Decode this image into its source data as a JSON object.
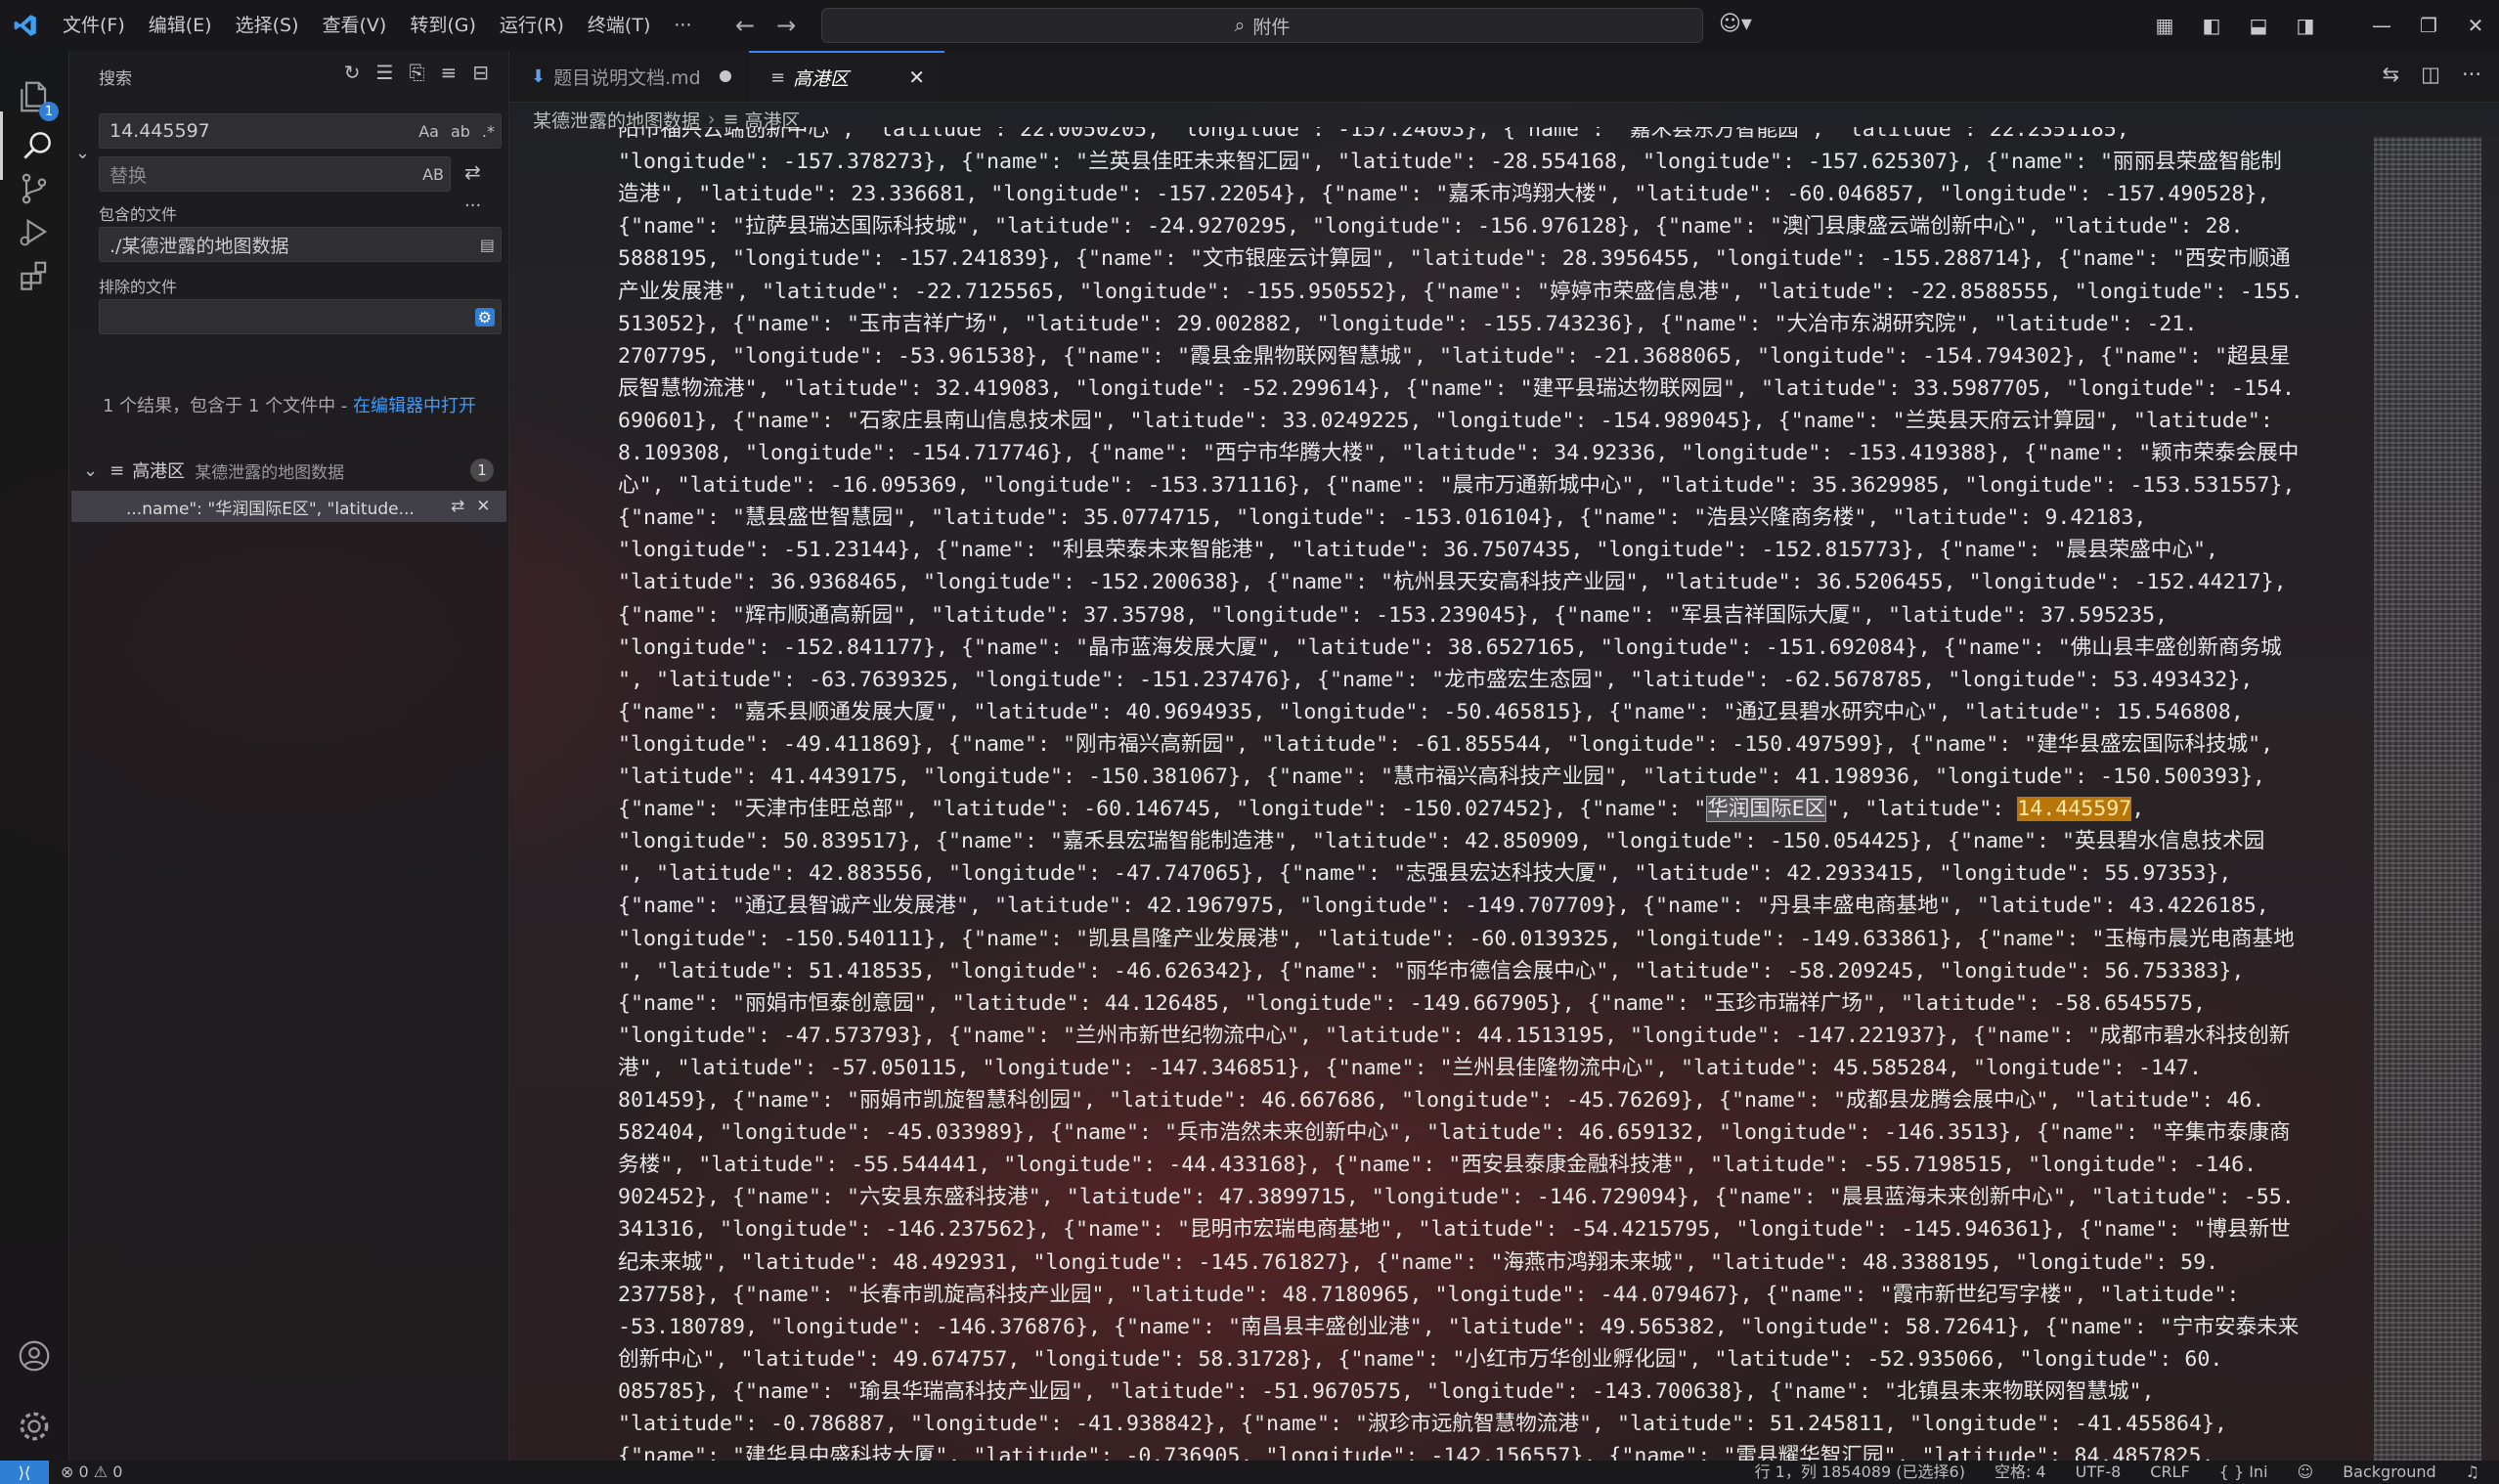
{
  "titlebar": {
    "menu": [
      "文件(F)",
      "编辑(E)",
      "选择(S)",
      "查看(V)",
      "转到(G)",
      "运行(R)",
      "终端(T)",
      "···"
    ],
    "command_center": "附件"
  },
  "activity": {
    "explorer_badge": "1"
  },
  "search": {
    "header": "搜索",
    "query": "14.445597",
    "query_tools": [
      "Aa",
      "ab",
      ".*"
    ],
    "replace_placeholder": "替换",
    "replace_tool": "AB",
    "include_label": "包含的文件",
    "include_value": "./某德泄露的地图数据",
    "exclude_label": "排除的文件",
    "exclude_value": "",
    "results_summary": "1 个结果，包含于 1 个文件中 - ",
    "open_in_editor": "在编辑器中打开",
    "file": {
      "name": "高港区",
      "path": "某德泄露的地图数据",
      "count": "1"
    },
    "match": "...name\": \"华润国际E区\", \"latitude..."
  },
  "tabs": [
    {
      "label": "题目说明文档.md",
      "modified": true
    },
    {
      "label": "高港区",
      "active": true
    }
  ],
  "breadcrumb": [
    "某德泄露的地图数据",
    "高港区"
  ],
  "editor": {
    "line_segments": [
      [
        "阳市福兴云端创新中心\", \"latitude\": 22.0050205, \"longitude\": -157.24603}, {\"name\": \"嘉禾县东方智能园\", \"latitude\": 22.2351185,"
      ],
      [
        "\"longitude\": -157.378273}, {\"name\": \"兰英县佳旺未来智汇园\", \"latitude\": -28.554168, \"longitude\": -157.625307}, {\"name\": \"丽丽县荣盛智能制"
      ],
      [
        "造港\", \"latitude\": 23.336681, \"longitude\": -157.22054}, {\"name\": \"嘉禾市鸿翔大楼\", \"latitude\": -60.046857, \"longitude\": -157.490528},"
      ],
      [
        "{\"name\": \"拉萨县瑞达国际科技城\", \"latitude\": -24.9270295, \"longitude\": -156.976128}, {\"name\": \"澳门县康盛云端创新中心\", \"latitude\": 28."
      ],
      [
        "5888195, \"longitude\": -157.241839}, {\"name\": \"文市银座云计算园\", \"latitude\": 28.3956455, \"longitude\": -155.288714}, {\"name\": \"西安市顺通"
      ],
      [
        "产业发展港\", \"latitude\": -22.7125565, \"longitude\": -155.950552}, {\"name\": \"婷婷市荣盛信息港\", \"latitude\": -22.8588555, \"longitude\": -155."
      ],
      [
        "513052}, {\"name\": \"玉市吉祥广场\", \"latitude\": 29.002882, \"longitude\": -155.743236}, {\"name\": \"大冶市东湖研究院\", \"latitude\": -21."
      ],
      [
        "2707795, \"longitude\": -53.961538}, {\"name\": \"霞县金鼎物联网智慧城\", \"latitude\": -21.3688065, \"longitude\": -154.794302}, {\"name\": \"超县星"
      ],
      [
        "辰智慧物流港\", \"latitude\": 32.419083, \"longitude\": -52.299614}, {\"name\": \"建平县瑞达物联网园\", \"latitude\": 33.5987705, \"longitude\": -154."
      ],
      [
        "690601}, {\"name\": \"石家庄县南山信息技术园\", \"latitude\": 33.0249225, \"longitude\": -154.989045}, {\"name\": \"兰英县天府云计算园\", \"latitude\":"
      ],
      [
        "8.109308, \"longitude\": -154.717746}, {\"name\": \"西宁市华腾大楼\", \"latitude\": 34.92336, \"longitude\": -153.419388}, {\"name\": \"颖市荣泰会展中"
      ],
      [
        "心\", \"latitude\": -16.095369, \"longitude\": -153.371116}, {\"name\": \"晨市万通新城中心\", \"latitude\": 35.3629985, \"longitude\": -153.531557},"
      ],
      [
        "{\"name\": \"慧县盛世智慧园\", \"latitude\": 35.0774715, \"longitude\": -153.016104}, {\"name\": \"浩县兴隆商务楼\", \"latitude\": 9.42183,"
      ],
      [
        "\"longitude\": -51.23144}, {\"name\": \"利县荣泰未来智能港\", \"latitude\": 36.7507435, \"longitude\": -152.815773}, {\"name\": \"晨县荣盛中心\","
      ],
      [
        "\"latitude\": 36.9368465, \"longitude\": -152.200638}, {\"name\": \"杭州县天安高科技产业园\", \"latitude\": 36.5206455, \"longitude\": -152.44217},"
      ],
      [
        "{\"name\": \"辉市顺通高新园\", \"latitude\": 37.35798, \"longitude\": -153.239045}, {\"name\": \"军县吉祥国际大厦\", \"latitude\": 37.595235,"
      ],
      [
        "\"longitude\": -152.841177}, {\"name\": \"晶市蓝海发展大厦\", \"latitude\": 38.6527165, \"longitude\": -151.692084}, {\"name\": \"佛山县丰盛创新商务城"
      ],
      [
        "\", \"latitude\": -63.7639325, \"longitude\": -151.237476}, {\"name\": \"龙市盛宏生态园\", \"latitude\": -62.5678785, \"longitude\": 53.493432},"
      ],
      [
        "{\"name\": \"嘉禾县顺通发展大厦\", \"latitude\": 40.9694935, \"longitude\": -50.465815}, {\"name\": \"通辽县碧水研究中心\", \"latitude\": 15.546808,"
      ],
      [
        "\"longitude\": -49.411869}, {\"name\": \"刚市福兴高新园\", \"latitude\": -61.855544, \"longitude\": -150.497599}, {\"name\": \"建华县盛宏国际科技城\","
      ],
      [
        "\"latitude\": 41.4439175, \"longitude\": -150.381067}, {\"name\": \"慧市福兴高科技产业园\", \"latitude\": 41.198936, \"longitude\": -150.500393},"
      ],
      [
        "{\"name\": \"天津市佳旺总部\", \"latitude\": -60.146745, \"longitude\": -150.027452}, {\"name\": \"",
        "华润国际E区",
        "\", \"latitude\": ",
        "14.445597",
        ","
      ],
      [
        "\"longitude\": 50.839517}, {\"name\": \"嘉禾县宏瑞智能制造港\", \"latitude\": 42.850909, \"longitude\": -150.054425}, {\"name\": \"英县碧水信息技术园"
      ],
      [
        "\", \"latitude\": 42.883556, \"longitude\": -47.747065}, {\"name\": \"志强县宏达科技大厦\", \"latitude\": 42.2933415, \"longitude\": 55.97353},"
      ],
      [
        "{\"name\": \"通辽县智诚产业发展港\", \"latitude\": 42.1967975, \"longitude\": -149.707709}, {\"name\": \"丹县丰盛电商基地\", \"latitude\": 43.4226185,"
      ],
      [
        "\"longitude\": -150.540111}, {\"name\": \"凯县昌隆产业发展港\", \"latitude\": -60.0139325, \"longitude\": -149.633861}, {\"name\": \"玉梅市晨光电商基地"
      ],
      [
        "\", \"latitude\": 51.418535, \"longitude\": -46.626342}, {\"name\": \"丽华市德信会展中心\", \"latitude\": -58.209245, \"longitude\": 56.753383},"
      ],
      [
        "{\"name\": \"丽娟市恒泰创意园\", \"latitude\": 44.126485, \"longitude\": -149.667905}, {\"name\": \"玉珍市瑞祥广场\", \"latitude\": -58.6545575,"
      ],
      [
        "\"longitude\": -47.573793}, {\"name\": \"兰州市新世纪物流中心\", \"latitude\": 44.1513195, \"longitude\": -147.221937}, {\"name\": \"成都市碧水科技创新"
      ],
      [
        "港\", \"latitude\": -57.050115, \"longitude\": -147.346851}, {\"name\": \"兰州县佳隆物流中心\", \"latitude\": 45.585284, \"longitude\": -147."
      ],
      [
        "801459}, {\"name\": \"丽娟市凯旋智慧科创园\", \"latitude\": 46.667686, \"longitude\": -45.76269}, {\"name\": \"成都县龙腾会展中心\", \"latitude\": 46."
      ],
      [
        "582404, \"longitude\": -45.033989}, {\"name\": \"兵市浩然未来创新中心\", \"latitude\": 46.659132, \"longitude\": -146.3513}, {\"name\": \"辛集市泰康商"
      ],
      [
        "务楼\", \"latitude\": -55.544441, \"longitude\": -44.433168}, {\"name\": \"西安县泰康金融科技港\", \"latitude\": -55.7198515, \"longitude\": -146."
      ],
      [
        "902452}, {\"name\": \"六安县东盛科技港\", \"latitude\": 47.3899715, \"longitude\": -146.729094}, {\"name\": \"晨县蓝海未来创新中心\", \"latitude\": -55."
      ],
      [
        "341316, \"longitude\": -146.237562}, {\"name\": \"昆明市宏瑞电商基地\", \"latitude\": -54.4215795, \"longitude\": -145.946361}, {\"name\": \"博县新世"
      ],
      [
        "纪未来城\", \"latitude\": 48.492931, \"longitude\": -145.761827}, {\"name\": \"海燕市鸿翔未来城\", \"latitude\": 48.3388195, \"longitude\": 59."
      ],
      [
        "237758}, {\"name\": \"长春市凯旋高科技产业园\", \"latitude\": 48.7180965, \"longitude\": -44.079467}, {\"name\": \"霞市新世纪写字楼\", \"latitude\":"
      ],
      [
        "-53.180789, \"longitude\": -146.376876}, {\"name\": \"南昌县丰盛创业港\", \"latitude\": 49.565382, \"longitude\": 58.72641}, {\"name\": \"宁市安泰未来"
      ],
      [
        "创新中心\", \"latitude\": 49.674757, \"longitude\": 58.31728}, {\"name\": \"小红市万华创业孵化园\", \"latitude\": -52.935066, \"longitude\": 60."
      ],
      [
        "085785}, {\"name\": \"瑜县华瑞高科技产业园\", \"latitude\": -51.9670575, \"longitude\": -143.700638}, {\"name\": \"北镇县未来物联网智慧城\","
      ],
      [
        "\"latitude\": -0.786887, \"longitude\": -41.938842}, {\"name\": \"淑珍市远航智慧物流港\", \"latitude\": 51.245811, \"longitude\": -41.455864},"
      ],
      [
        "{\"name\": \"建华县中盛科技大厦\", \"latitude\": -0.736905, \"longitude\": -142.156557}, {\"name\": \"雷县耀华智汇园\", \"latitude\": 84.4857825,"
      ]
    ]
  },
  "statusbar": {
    "problems": "⊗ 0 ⚠ 0",
    "position": "行 1，列 1854089 (已选择6)",
    "indent": "空格: 4",
    "encoding": "UTF-8",
    "eol": "CRLF",
    "language": "{ } Ini",
    "background": "Background"
  }
}
